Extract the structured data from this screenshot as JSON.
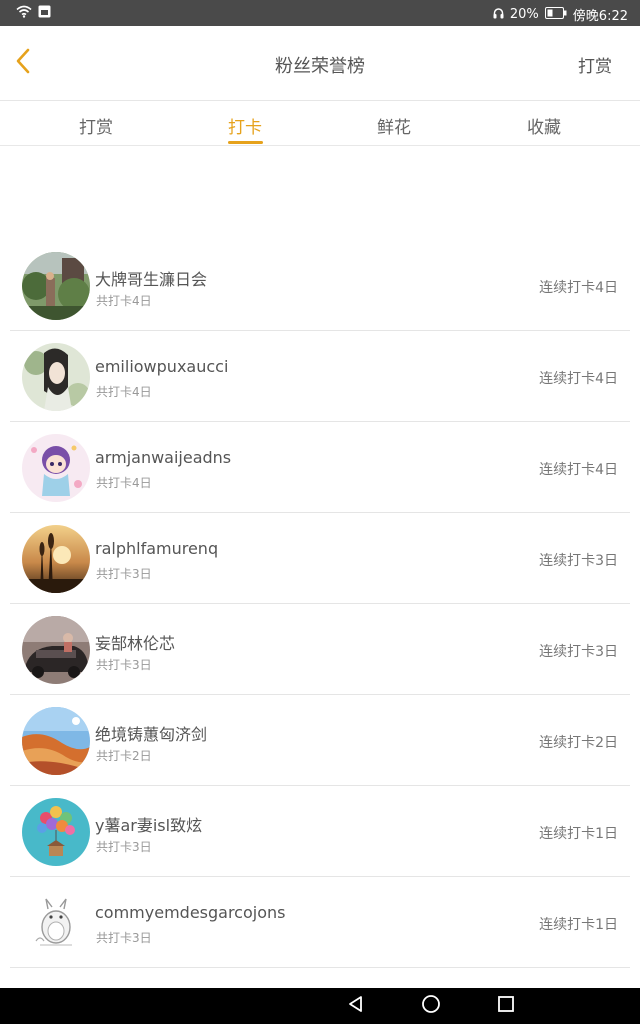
{
  "status_bar": {
    "battery": "20%",
    "time": "傍晚6:22"
  },
  "header": {
    "title": "粉丝荣誉榜",
    "action_label": "打赏"
  },
  "tabs": [
    {
      "label": "打赏"
    },
    {
      "label": "打卡"
    },
    {
      "label": "鲜花"
    },
    {
      "label": "收藏"
    }
  ],
  "active_tab": "打卡",
  "colors": {
    "accent": "#e6a21c",
    "text": "#555555",
    "muted": "#999999"
  },
  "fans": [
    {
      "name": "大牌哥生濂日会",
      "total": "共打卡4日",
      "streak": "连续打卡4日",
      "avatar": "garden-avatar"
    },
    {
      "name": "emiliowpuxaucci",
      "total": "共打卡4日",
      "streak": "连续打卡4日",
      "avatar": "portrait-avatar"
    },
    {
      "name": "armjanwaijeadns",
      "total": "共打卡4日",
      "streak": "连续打卡4日",
      "avatar": "anime-avatar"
    },
    {
      "name": "ralphlfamurenq",
      "total": "共打卡3日",
      "streak": "连续打卡3日",
      "avatar": "sunset-avatar"
    },
    {
      "name": "妄郜林伦芯",
      "total": "共打卡3日",
      "streak": "连续打卡3日",
      "avatar": "car-avatar"
    },
    {
      "name": "绝境铸蕙匈济剑",
      "total": "共打卡2日",
      "streak": "连续打卡2日",
      "avatar": "canyon-avatar"
    },
    {
      "name": "y薯ar妻isl致炫",
      "total": "共打卡3日",
      "streak": "连续打卡1日",
      "avatar": "balloon-avatar"
    },
    {
      "name": "commyemdesgarcojons",
      "total": "共打卡3日",
      "streak": "连续打卡1日",
      "avatar": "totoro-avatar"
    }
  ]
}
